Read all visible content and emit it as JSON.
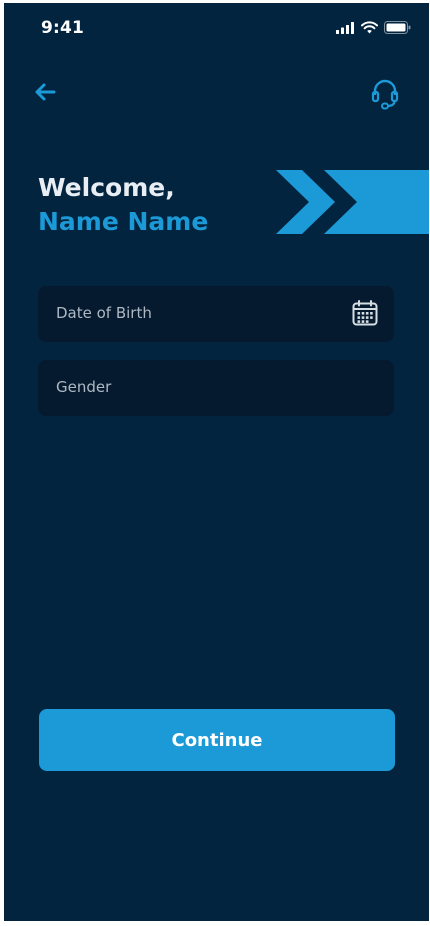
{
  "status_bar": {
    "time": "9:41",
    "icons": [
      "signal-icon",
      "wifi-icon",
      "battery-icon"
    ]
  },
  "header": {
    "back_icon": "arrow-left-icon",
    "support_icon": "headset-icon"
  },
  "welcome": {
    "label": "Welcome,",
    "name": "Name Name"
  },
  "form": {
    "dob_placeholder": "Date of Birth",
    "dob_icon": "calendar-icon",
    "gender_placeholder": "Gender"
  },
  "actions": {
    "continue_label": "Continue"
  },
  "colors": {
    "background": "#02243f",
    "accent": "#1c9ad8",
    "field": "#051a2e"
  }
}
